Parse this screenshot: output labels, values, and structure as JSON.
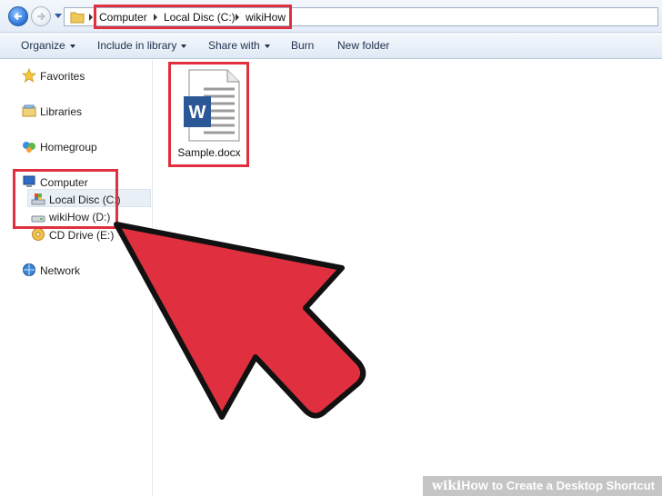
{
  "address_bar": {
    "crumbs": [
      "Computer",
      "Local Disc (C:)",
      "wikiHow"
    ]
  },
  "command_bar": {
    "organize": "Organize",
    "include_in_library": "Include in library",
    "share_with": "Share with",
    "burn": "Burn",
    "new_folder": "New folder"
  },
  "sidebar": {
    "favorites": "Favorites",
    "libraries": "Libraries",
    "homegroup": "Homegroup",
    "computer": "Computer",
    "local_disc": "Local Disc (C:)",
    "wikihow_drive": "wikiHow (D:)",
    "cd_drive": "CD Drive (E:)",
    "network": "Network"
  },
  "files": [
    {
      "name": "Sample.docx",
      "icon": "word-document-icon"
    }
  ],
  "colors": {
    "highlight": "#e0303f",
    "arrow_fill": "#e0303f",
    "arrow_outline": "#111111"
  },
  "watermark": {
    "wiki": "wiki",
    "how": "How",
    "title": "to Create a Desktop Shortcut"
  }
}
